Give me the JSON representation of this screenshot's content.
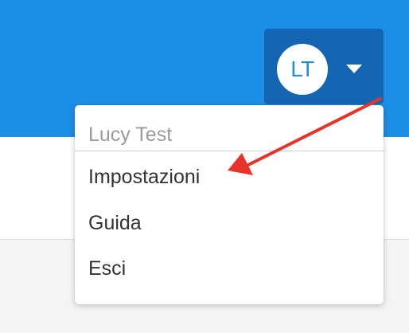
{
  "user": {
    "initials": "LT",
    "name": "Lucy Test"
  },
  "menu": {
    "items": [
      {
        "label": "Impostazioni"
      },
      {
        "label": "Guida"
      },
      {
        "label": "Esci"
      }
    ]
  },
  "colors": {
    "header": "#1b8fe6",
    "user_button": "#1466b3",
    "arrow": "#e8332a"
  },
  "icons": {
    "caret": "caret-down-icon",
    "arrow": "red-arrow-annotation"
  }
}
